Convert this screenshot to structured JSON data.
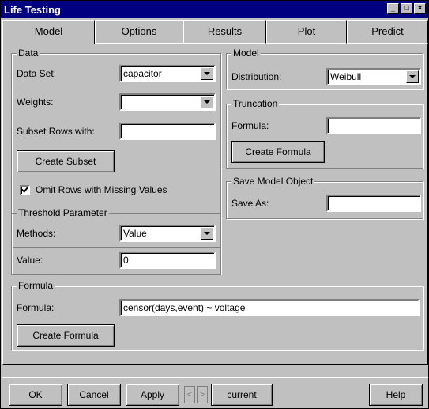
{
  "window": {
    "title": "Life Testing"
  },
  "titlebar_buttons": {
    "minimize": "_",
    "maximize": "□",
    "close": "×"
  },
  "tabs": [
    {
      "label": "Model"
    },
    {
      "label": "Options"
    },
    {
      "label": "Results"
    },
    {
      "label": "Plot"
    },
    {
      "label": "Predict"
    }
  ],
  "data_group": {
    "title": "Data",
    "data_set_label": "Data Set:",
    "data_set_value": "capacitor",
    "weights_label": "Weights:",
    "weights_value": "",
    "subset_label": "Subset Rows with:",
    "subset_value": "",
    "create_subset_label": "Create Subset",
    "omit_label": "Omit Rows with Missing Values",
    "omit_checked": true
  },
  "threshold_group": {
    "title": "Threshold Parameter",
    "methods_label": "Methods:",
    "methods_value": "Value",
    "value_label": "Value:",
    "value_value": "0"
  },
  "model_group": {
    "title": "Model",
    "distribution_label": "Distribution:",
    "distribution_value": "Weibull"
  },
  "truncation_group": {
    "title": "Truncation",
    "formula_label": "Formula:",
    "formula_value": "",
    "create_formula_label": "Create Formula"
  },
  "save_group": {
    "title": "Save Model Object",
    "save_as_label": "Save As:",
    "save_as_value": ""
  },
  "formula_group": {
    "title": "Formula",
    "formula_label": "Formula:",
    "formula_value": "censor(days,event) ~ voltage",
    "create_formula_label": "Create Formula"
  },
  "footer": {
    "ok_label": "OK",
    "cancel_label": "Cancel",
    "apply_label": "Apply",
    "prev_glyph": "<",
    "next_glyph": ">",
    "current_label": "current",
    "help_label": "Help"
  }
}
